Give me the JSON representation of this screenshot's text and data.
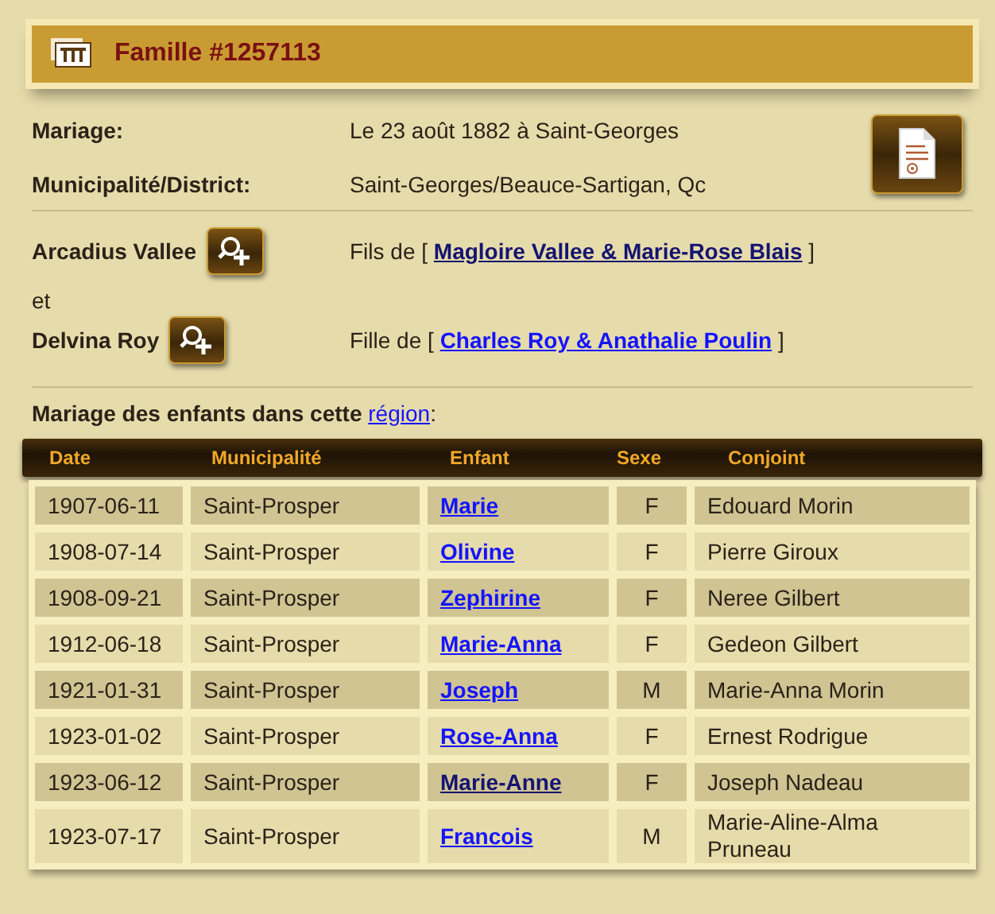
{
  "header": {
    "title": "Famille #1257113"
  },
  "info": [
    {
      "label": "Mariage:",
      "value": "Le 23 août 1882 à Saint-Georges"
    },
    {
      "label": "Municipalité/District:",
      "value": "Saint-Georges/Beauce-Sartigan, Qc"
    }
  ],
  "spouses": [
    {
      "name": "Arcadius Vallee",
      "relation": "Fils de [ ",
      "parents": "Magloire Vallee & Marie-Rose Blais",
      "visited": true,
      "close": " ]"
    },
    {
      "name": "Delvina Roy",
      "relation": "Fille de [ ",
      "parents": "Charles Roy & Anathalie Poulin",
      "visited": false,
      "close": " ]"
    }
  ],
  "conjunction": "et",
  "section": {
    "text": "Mariage des enfants dans cette ",
    "link": "région",
    "after": ":"
  },
  "table": {
    "columns": [
      "Date",
      "Municipalité",
      "Enfant",
      "Sexe",
      "Conjoint"
    ],
    "rows": [
      {
        "date": "1907-06-11",
        "municipality": "Saint-Prosper",
        "child": "Marie",
        "visited": false,
        "sex": "F",
        "spouse": "Edouard Morin"
      },
      {
        "date": "1908-07-14",
        "municipality": "Saint-Prosper",
        "child": "Olivine",
        "visited": false,
        "sex": "F",
        "spouse": "Pierre Giroux"
      },
      {
        "date": "1908-09-21",
        "municipality": "Saint-Prosper",
        "child": "Zephirine",
        "visited": false,
        "sex": "F",
        "spouse": "Neree Gilbert"
      },
      {
        "date": "1912-06-18",
        "municipality": "Saint-Prosper",
        "child": "Marie-Anna",
        "visited": false,
        "sex": "F",
        "spouse": "Gedeon Gilbert"
      },
      {
        "date": "1921-01-31",
        "municipality": "Saint-Prosper",
        "child": "Joseph",
        "visited": false,
        "sex": "M",
        "spouse": "Marie-Anna Morin"
      },
      {
        "date": "1923-01-02",
        "municipality": "Saint-Prosper",
        "child": "Rose-Anna",
        "visited": false,
        "sex": "F",
        "spouse": "Ernest Rodrigue"
      },
      {
        "date": "1923-06-12",
        "municipality": "Saint-Prosper",
        "child": "Marie-Anne",
        "visited": true,
        "sex": "F",
        "spouse": "Joseph Nadeau"
      },
      {
        "date": "1923-07-17",
        "municipality": "Saint-Prosper",
        "child": "Francois",
        "visited": false,
        "sex": "M",
        "spouse": "Marie-Aline-Alma Pruneau"
      }
    ]
  }
}
